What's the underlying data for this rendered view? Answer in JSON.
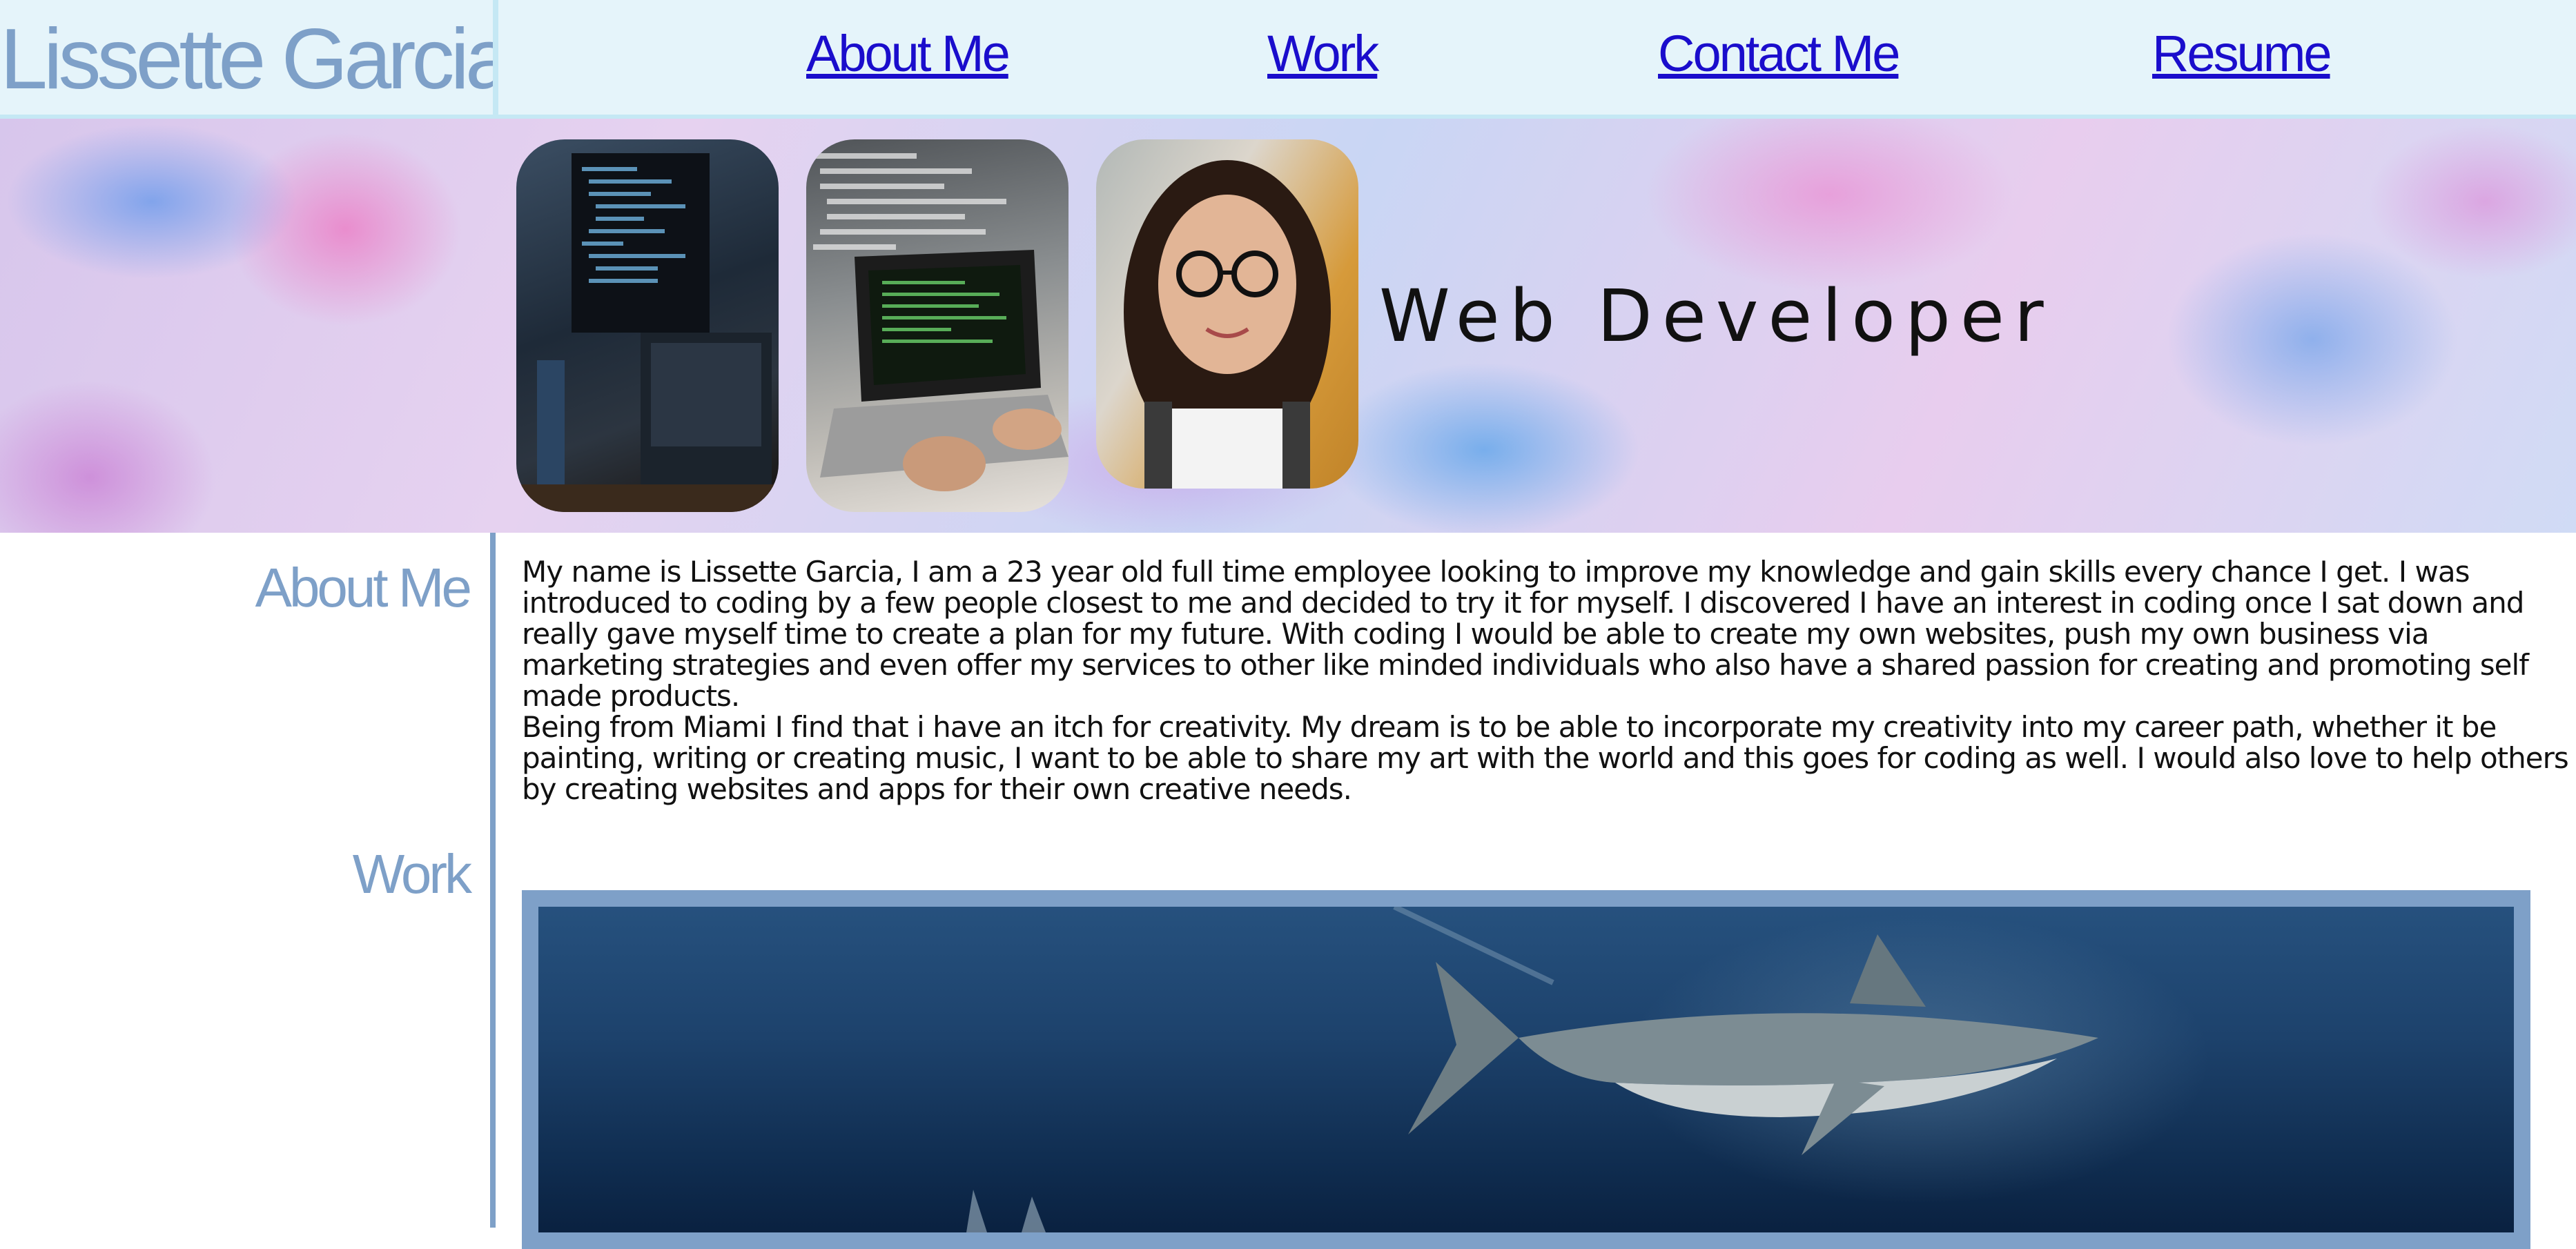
{
  "header": {
    "site_name": "Lissette Garcia",
    "nav": [
      {
        "label": "About Me"
      },
      {
        "label": "Work"
      },
      {
        "label": "Contact Me"
      },
      {
        "label": "Resume"
      }
    ]
  },
  "hero": {
    "tagline": "Web Developer",
    "photos": [
      {
        "subject": "code-on-monitor-image"
      },
      {
        "subject": "laptop-coding-image"
      },
      {
        "subject": "portrait-image"
      }
    ]
  },
  "about": {
    "title": "About Me",
    "paragraphs": [
      "My name is Lissette Garcia, I am a 23 year old full time employee looking to improve my knowledge and gain skills every chance I get. I was introduced to coding by a few people closest to me and decided to try it for myself. I discovered I have an interest in coding once I sat down and really gave myself time to create a plan for my future. With coding I would be able to create my own websites, push my own business via marketing strategies and even offer my services to other like minded individuals who also have a shared passion for creating and promoting self made products.",
      "Being from Miami I find that i have an itch for creativity. My dream is to be able to incorporate my creativity into my career path, whether it be painting, writing or creating music, I want to be able to share my art with the world and this goes for coding as well. I would also love to help others by creating websites and apps for their own creative needs."
    ]
  },
  "work": {
    "title": "Work",
    "project_image": "shark-underwater-image"
  },
  "colors": {
    "header_bg": "#e5f4fa",
    "accent": "#7ea0c8",
    "link": "#1a0dcc",
    "text": "#111111"
  }
}
